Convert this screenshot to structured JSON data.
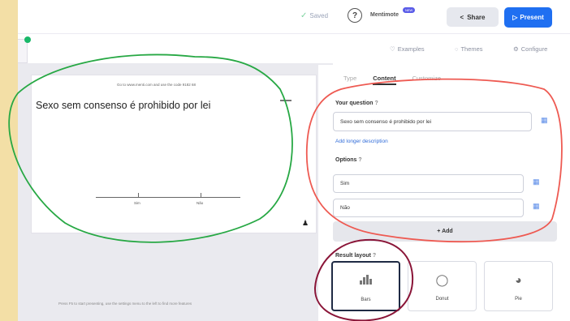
{
  "topbar": {
    "saved_label": "Saved",
    "mentimote_label": "Mentimote",
    "beta_label": "NEW",
    "share_label": "Share",
    "present_label": "Present"
  },
  "subtoolbar": {
    "examples_label": "Examples",
    "themes_label": "Themes",
    "configure_label": "Configure"
  },
  "slide": {
    "url_text": "Go to www.menti.com and use the code 9182 68",
    "title": "Sexo sem consenso é prohibido por lei",
    "tick_labels": [
      "Sim",
      "Não"
    ]
  },
  "canvas_hint": "Press F5 to start presenting, use the settings menu to the left to find more features",
  "panel": {
    "tabs": [
      "Type",
      "Content",
      "Customize"
    ],
    "active_tab": "Content",
    "question_label": "Your question",
    "question_value": "Sexo sem consenso é prohibido por lei",
    "add_description": "Add longer description",
    "options_label": "Options",
    "options": [
      "Sim",
      "Não"
    ],
    "add_label": "+ Add",
    "result_layout_label": "Result layout",
    "layouts": [
      "Bars",
      "Donut",
      "Pie"
    ],
    "selected_layout": "Bars"
  },
  "colors": {
    "page_bg": "#f3dfa6",
    "present_blue": "#1f6ff1",
    "annotation_green": "#27a844",
    "annotation_red": "#ee5a52",
    "annotation_maroon": "#8a1538"
  }
}
